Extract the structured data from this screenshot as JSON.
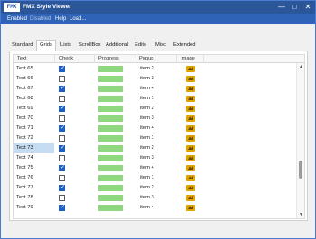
{
  "window": {
    "title": "FMX Style Viewer",
    "logo_text": "FMX"
  },
  "menubar": {
    "items": [
      "Enabled",
      "Disabled",
      "Help",
      "Load..."
    ]
  },
  "tabs": [
    "Standard",
    "Grids",
    "Lists",
    "ScrollBox",
    "Additional",
    "Edits",
    "Misc",
    "Extended"
  ],
  "grid": {
    "columns": [
      "Text",
      "Check",
      "Progress",
      "Popup",
      "Image"
    ],
    "rows": [
      {
        "text": "Text 65",
        "checked": true,
        "progress": 1.0,
        "popup": "item 2"
      },
      {
        "text": "Text 66",
        "checked": false,
        "progress": 1.0,
        "popup": "item 3"
      },
      {
        "text": "Text 67",
        "checked": true,
        "progress": 1.0,
        "popup": "item 4"
      },
      {
        "text": "Text 68",
        "checked": false,
        "progress": 1.0,
        "popup": "item 1"
      },
      {
        "text": "Text 69",
        "checked": true,
        "progress": 1.0,
        "popup": "item 2"
      },
      {
        "text": "Text 70",
        "checked": false,
        "progress": 1.0,
        "popup": "item 3"
      },
      {
        "text": "Text 71",
        "checked": true,
        "progress": 1.0,
        "popup": "item 4"
      },
      {
        "text": "Text 72",
        "checked": false,
        "progress": 1.0,
        "popup": "item 1"
      },
      {
        "text": "Text 73",
        "checked": true,
        "progress": 1.0,
        "popup": "item 2",
        "selected": true
      },
      {
        "text": "Text 74",
        "checked": false,
        "progress": 1.0,
        "popup": "item 3"
      },
      {
        "text": "Text 75",
        "checked": true,
        "progress": 1.0,
        "popup": "item 4"
      },
      {
        "text": "Text 76",
        "checked": false,
        "progress": 1.0,
        "popup": "item 1"
      },
      {
        "text": "Text 77",
        "checked": true,
        "progress": 1.0,
        "popup": "item 2"
      },
      {
        "text": "Text 78",
        "checked": false,
        "progress": 1.0,
        "popup": "item 3"
      },
      {
        "text": "Text 79",
        "checked": true,
        "progress": 1.0,
        "popup": "item 4"
      }
    ]
  },
  "colors": {
    "titlebar": "#2b579a",
    "menubar": "#2f63b7",
    "progress": "#8fd87f",
    "selection": "#c5dcf2",
    "checkbox": "#1f5fbf"
  }
}
